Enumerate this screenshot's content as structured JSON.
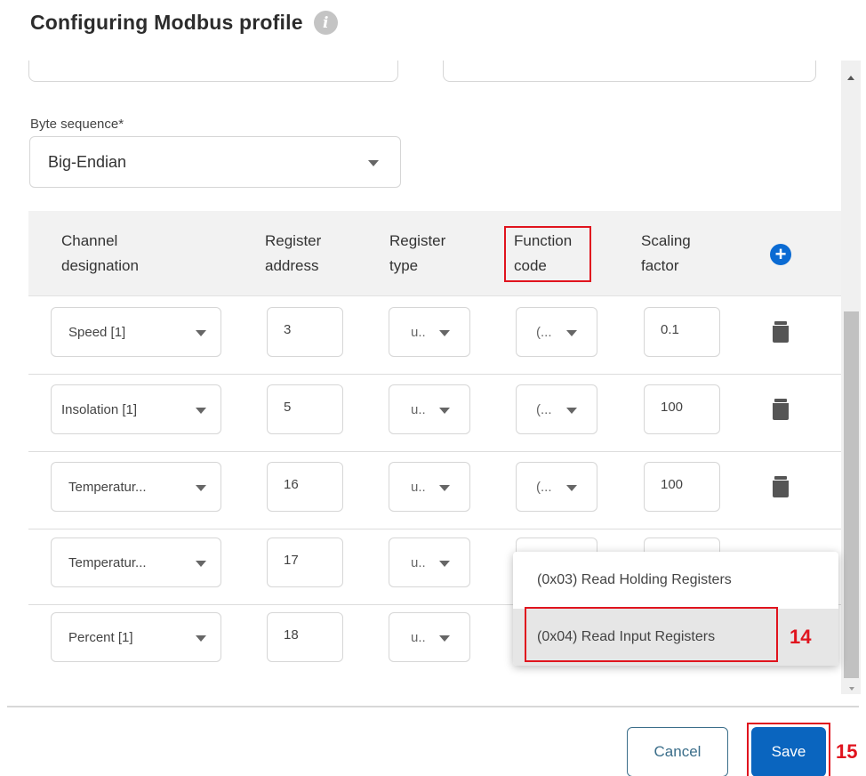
{
  "dialog": {
    "title": "Configuring Modbus profile",
    "info_icon": "i"
  },
  "form": {
    "byte_sequence_label": "Byte sequence*",
    "byte_sequence_value": "Big-Endian"
  },
  "table": {
    "headers": {
      "channel": [
        "Channel",
        "designation"
      ],
      "register_address": [
        "Register",
        "address"
      ],
      "register_type": [
        "Register",
        "type"
      ],
      "function_code": [
        "Function",
        "code"
      ],
      "scaling_factor": [
        "Scaling",
        "factor"
      ]
    },
    "add_icon": "plus-circle-icon",
    "rows": [
      {
        "channel": "Speed [1]",
        "address": "3",
        "type": "u..",
        "function": "(...",
        "scaling": "0.1"
      },
      {
        "channel": "Insolation [1]",
        "address": "5",
        "type": "u..",
        "function": "(...",
        "scaling": "100"
      },
      {
        "channel": "Temperatur...",
        "address": "16",
        "type": "u..",
        "function": "(...",
        "scaling": "100"
      },
      {
        "channel": "Temperatur...",
        "address": "17",
        "type": "u..",
        "function": "",
        "scaling": ""
      },
      {
        "channel": "Percent [1]",
        "address": "18",
        "type": "u..",
        "function": "",
        "scaling": ""
      }
    ]
  },
  "function_dropdown": {
    "options": [
      "(0x03) Read Holding Registers",
      "(0x04) Read Input Registers"
    ],
    "highlighted": "(0x04) Read Input Registers"
  },
  "annotations": {
    "step_14": "14",
    "step_15": "15",
    "highlight_color": "#e0141e"
  },
  "footer": {
    "cancel_label": "Cancel",
    "save_label": "Save"
  },
  "colors": {
    "primary": "#0a65bf",
    "header_bg": "#f2f2f2"
  }
}
